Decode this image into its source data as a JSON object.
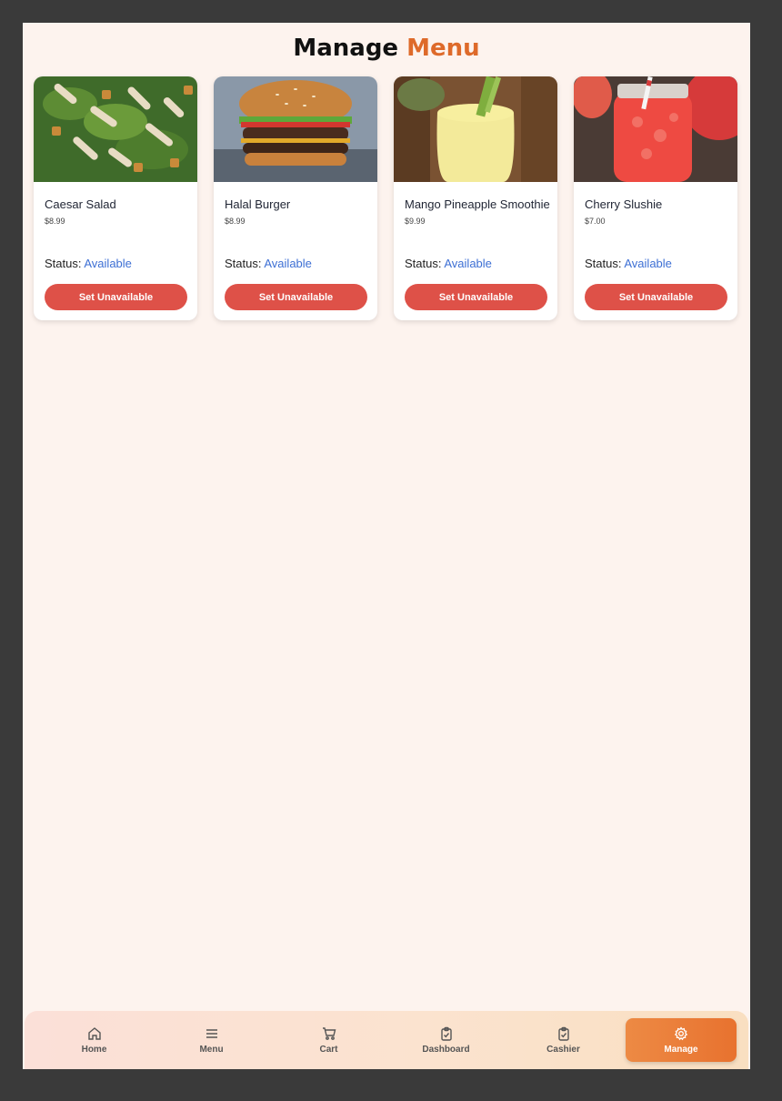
{
  "header": {
    "title_part1": "Manage",
    "title_part2": "Menu",
    "accent_color": "#de6a2a"
  },
  "items": [
    {
      "name": "Caesar Salad",
      "price": "$8.99",
      "status_label": "Status:",
      "status": "Available",
      "action": "Set Unavailable",
      "image": "caesar-salad-image"
    },
    {
      "name": "Halal Burger",
      "price": "$8.99",
      "status_label": "Status:",
      "status": "Available",
      "action": "Set Unavailable",
      "image": "burger-image"
    },
    {
      "name": "Mango Pineapple Smoothie",
      "price": "$9.99",
      "status_label": "Status:",
      "status": "Available",
      "action": "Set Unavailable",
      "image": "smoothie-image"
    },
    {
      "name": "Cherry Slushie",
      "price": "$7.00",
      "status_label": "Status:",
      "status": "Available",
      "action": "Set Unavailable",
      "image": "slushie-image"
    }
  ],
  "nav": [
    {
      "label": "Home",
      "icon": "home-icon",
      "active": false
    },
    {
      "label": "Menu",
      "icon": "menu-icon",
      "active": false
    },
    {
      "label": "Cart",
      "icon": "cart-icon",
      "active": false
    },
    {
      "label": "Dashboard",
      "icon": "clipboard-icon",
      "active": false
    },
    {
      "label": "Cashier",
      "icon": "clipboard-icon",
      "active": false
    },
    {
      "label": "Manage",
      "icon": "gear-icon",
      "active": true
    }
  ],
  "colors": {
    "background": "#fdf3ee",
    "button": "#de5148",
    "status": "#3d6fd4",
    "nav_active": "#e8722f"
  }
}
